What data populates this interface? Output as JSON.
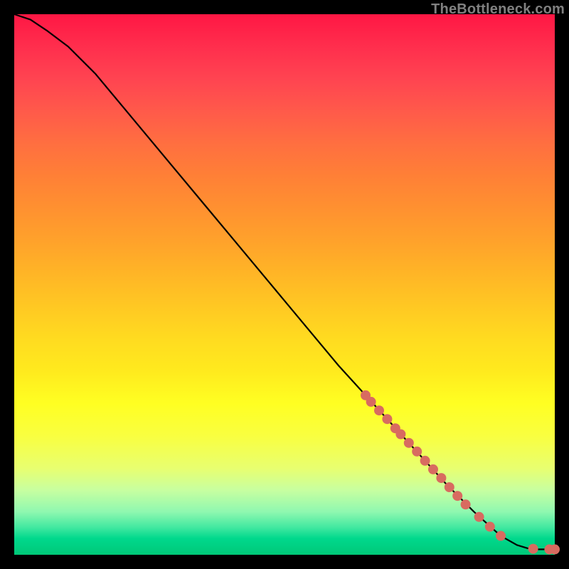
{
  "watermark": "TheBottleneck.com",
  "chart_data": {
    "type": "line",
    "title": "",
    "xlabel": "",
    "ylabel": "",
    "xlim": [
      0,
      100
    ],
    "ylim": [
      0,
      100
    ],
    "line": {
      "x": [
        0,
        3,
        6,
        10,
        15,
        20,
        25,
        30,
        35,
        40,
        45,
        50,
        55,
        60,
        65,
        70,
        75,
        80,
        85,
        90,
        93,
        95,
        97,
        100
      ],
      "y": [
        100,
        99,
        97,
        94,
        89,
        83,
        77,
        71,
        65,
        59,
        53,
        47,
        41,
        35,
        29.5,
        24,
        18.5,
        13,
        8,
        3.5,
        1.8,
        1.2,
        1.0,
        1.0
      ]
    },
    "markers": {
      "x": [
        65,
        66,
        67.5,
        69,
        70.5,
        71.5,
        73,
        74.5,
        76,
        77.5,
        79,
        80.5,
        82,
        83.5,
        86,
        88,
        90,
        96,
        99,
        100
      ],
      "y": [
        29.5,
        28.3,
        26.7,
        25.1,
        23.4,
        22.3,
        20.7,
        19.1,
        17.4,
        15.8,
        14.2,
        12.5,
        10.9,
        9.3,
        7.0,
        5.2,
        3.5,
        1.1,
        1.0,
        1.0
      ]
    },
    "colors": {
      "line": "#000000",
      "marker": "#d86b60"
    }
  }
}
